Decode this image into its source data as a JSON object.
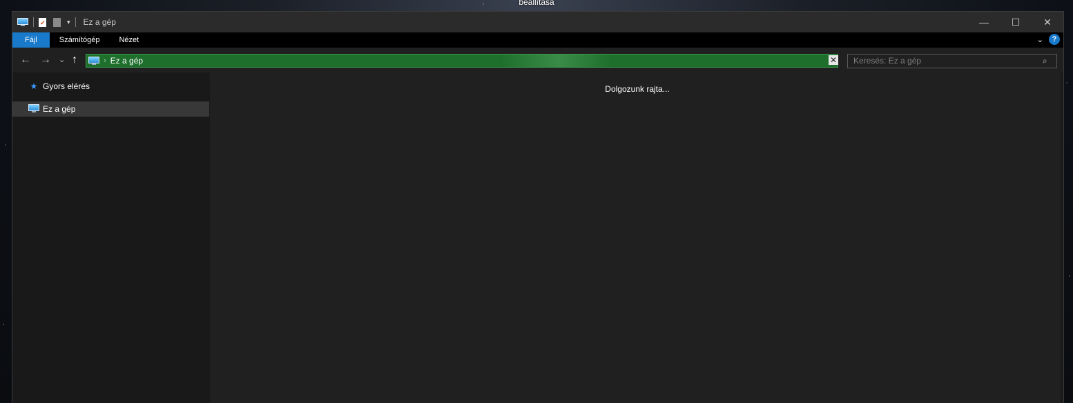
{
  "desktop": {
    "label": "beállítása"
  },
  "titlebar": {
    "title": "Ez a gép",
    "icons": [
      "computer-icon",
      "properties-icon",
      "new-folder-icon",
      "customize-qat-icon"
    ],
    "controls": {
      "minimize": "—",
      "maximize": "☐",
      "close": "✕"
    }
  },
  "ribbon": {
    "tabs": [
      {
        "label": "Fájl",
        "active": true
      },
      {
        "label": "Számítógép",
        "active": false
      },
      {
        "label": "Nézet",
        "active": false
      }
    ],
    "expand_icon": "chevron-down-icon",
    "help_label": "?"
  },
  "navigation": {
    "back": "←",
    "forward": "→",
    "recent": "⌄",
    "up": "↑"
  },
  "address": {
    "crumb": "Ez a gép",
    "separator": "›",
    "dropdown": "⌄",
    "clear": "✕"
  },
  "search": {
    "placeholder": "Keresés: Ez a gép",
    "icon": "⌕"
  },
  "sidebar": {
    "items": [
      {
        "label": "Gyors elérés",
        "icon": "star-icon",
        "selected": false
      },
      {
        "label": "Ez a gép",
        "icon": "computer-icon",
        "selected": true
      }
    ]
  },
  "content": {
    "status": "Dolgozunk rajta..."
  },
  "colors": {
    "accent": "#1979ca",
    "address_bar": "#1e6e2c",
    "window_bg": "#202020"
  }
}
